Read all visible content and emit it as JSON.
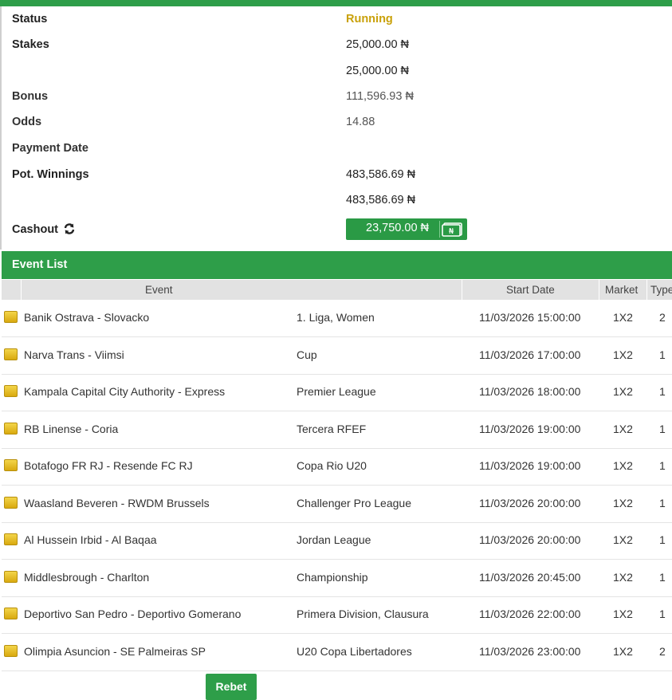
{
  "summary": {
    "status_label": "Status",
    "status_value": "Running",
    "stakes_label": "Stakes",
    "stakes_value_1": "25,000.00 ₦",
    "stakes_value_2": "25,000.00 ₦",
    "bonus_label": "Bonus",
    "bonus_value": "111,596.93 ₦",
    "odds_label": "Odds",
    "odds_value": "14.88",
    "payment_date_label": "Payment Date",
    "pot_winnings_label": "Pot. Winnings",
    "pot_winnings_value_1": "483,586.69 ₦",
    "pot_winnings_value_2": "483,586.69 ₦",
    "cashout_label": "Cashout",
    "cashout_amount": "23,750.00 ₦",
    "cashout_icon": "refresh-icon",
    "cashout_button_icon": "banknote-icon"
  },
  "event_list": {
    "title": "Event List",
    "columns": {
      "event": "Event",
      "start_date": "Start Date",
      "market": "Market",
      "type": "Type"
    },
    "rows": [
      {
        "event": "Banik Ostrava - Slovacko",
        "league": "1. Liga, Women",
        "start": "11/03/2026 15:00:00",
        "market": "1X2",
        "type": "2"
      },
      {
        "event": "Narva Trans - Viimsi",
        "league": "Cup",
        "start": "11/03/2026 17:00:00",
        "market": "1X2",
        "type": "1"
      },
      {
        "event": "Kampala Capital City Authority - Express",
        "league": "Premier League",
        "start": "11/03/2026 18:00:00",
        "market": "1X2",
        "type": "1"
      },
      {
        "event": "RB Linense - Coria",
        "league": "Tercera RFEF",
        "start": "11/03/2026 19:00:00",
        "market": "1X2",
        "type": "1"
      },
      {
        "event": "Botafogo FR RJ - Resende FC RJ",
        "league": "Copa Rio U20",
        "start": "11/03/2026 19:00:00",
        "market": "1X2",
        "type": "1"
      },
      {
        "event": "Waasland Beveren - RWDM Brussels",
        "league": "Challenger Pro League",
        "start": "11/03/2026 20:00:00",
        "market": "1X2",
        "type": "1"
      },
      {
        "event": "Al Hussein Irbid - Al Baqaa",
        "league": "Jordan League",
        "start": "11/03/2026 20:00:00",
        "market": "1X2",
        "type": "1"
      },
      {
        "event": "Middlesbrough - Charlton",
        "league": "Championship",
        "start": "11/03/2026 20:45:00",
        "market": "1X2",
        "type": "1"
      },
      {
        "event": "Deportivo San Pedro - Deportivo Gomerano",
        "league": "Primera Division, Clausura",
        "start": "11/03/2026 22:00:00",
        "market": "1X2",
        "type": "1"
      },
      {
        "event": "Olimpia Asuncion - SE Palmeiras SP",
        "league": "U20 Copa Libertadores",
        "start": "11/03/2026 23:00:00",
        "market": "1X2",
        "type": "2"
      }
    ],
    "row_icon": "soccer-ball-icon"
  },
  "actions": {
    "rebet_label": "Rebet"
  },
  "colors": {
    "accent_green": "#2e9e49",
    "running_yellow": "#c9a10a"
  }
}
